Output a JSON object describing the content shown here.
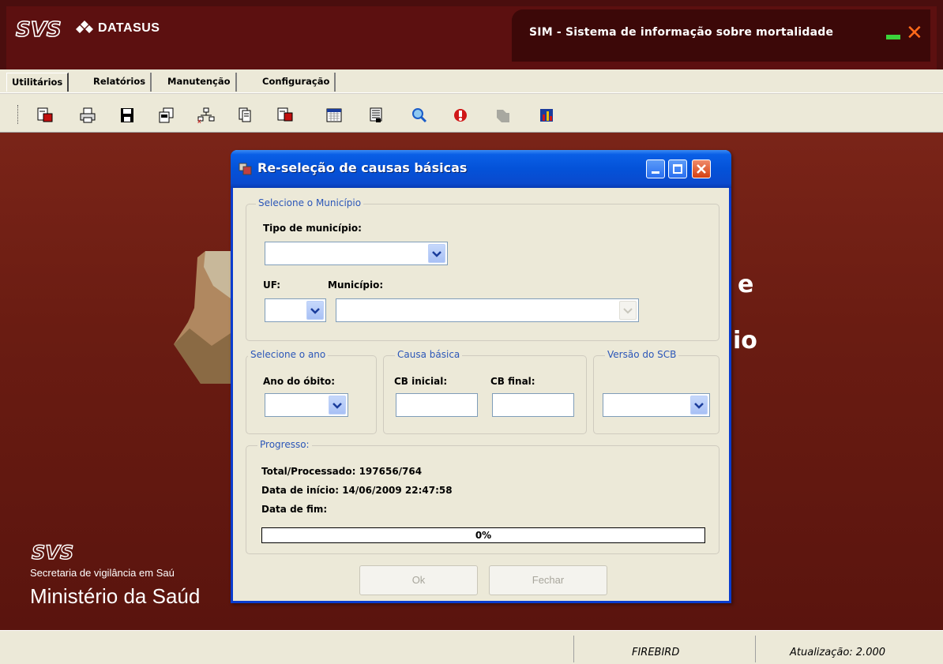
{
  "app": {
    "title": "SIM - Sistema de informação sobre mortalidade",
    "svs_logo": "SVS",
    "datasus_logo": "DATASUS"
  },
  "menu": {
    "items": [
      "Utilitários",
      "Relatórios",
      "Manutenção",
      "Configuração"
    ],
    "active": "Utilitários"
  },
  "toolbar": {
    "icons": [
      "new-record-icon",
      "print-icon",
      "save-icon",
      "copy-icon",
      "network-icon",
      "documents-icon",
      "export-icon",
      "calendar-icon",
      "card-icon",
      "search-icon",
      "refresh-icon",
      "map-icon",
      "chart-icon"
    ]
  },
  "background": {
    "text_line1": "e",
    "text_line2": "io",
    "svs_logo": "SVS",
    "secretaria": "Secretaria de vigilância em Saú",
    "ministerio": "Ministério da Saúd"
  },
  "dialog": {
    "title": "Re-seleção de causas básicas",
    "municipio_group": {
      "legend": "Selecione o Município",
      "tipo_label": "Tipo de município:",
      "tipo_value": "",
      "uf_label": "UF:",
      "uf_value": "",
      "municipio_label": "Município:",
      "municipio_value": ""
    },
    "ano_group": {
      "legend": "Selecione o ano",
      "ano_label": "Ano do óbito:",
      "ano_value": ""
    },
    "causa_group": {
      "legend": "Causa básica",
      "cb_inicial_label": "CB inicial:",
      "cb_inicial_value": "",
      "cb_final_label": "CB final:",
      "cb_final_value": ""
    },
    "versao_group": {
      "legend": "Versão do SCB",
      "versao_value": ""
    },
    "progress_group": {
      "legend": "Progresso:",
      "total_processado": "Total/Processado: 197656/764",
      "data_inicio": "Data de início: 14/06/2009 22:47:58",
      "data_fim": "Data de fim:",
      "progress_percent": 0,
      "progress_label": "0%"
    },
    "ok_button": "Ok",
    "fechar_button": "Fechar"
  },
  "statusbar": {
    "database": "FIREBIRD",
    "version": "Atualização: 2.000"
  },
  "colors": {
    "header_bg": "#5c1010",
    "main_bg": "#6a1c12",
    "dialog_title": "#0452d8",
    "legend_text": "#2b56b8",
    "close_x": "#ff6a1a"
  }
}
